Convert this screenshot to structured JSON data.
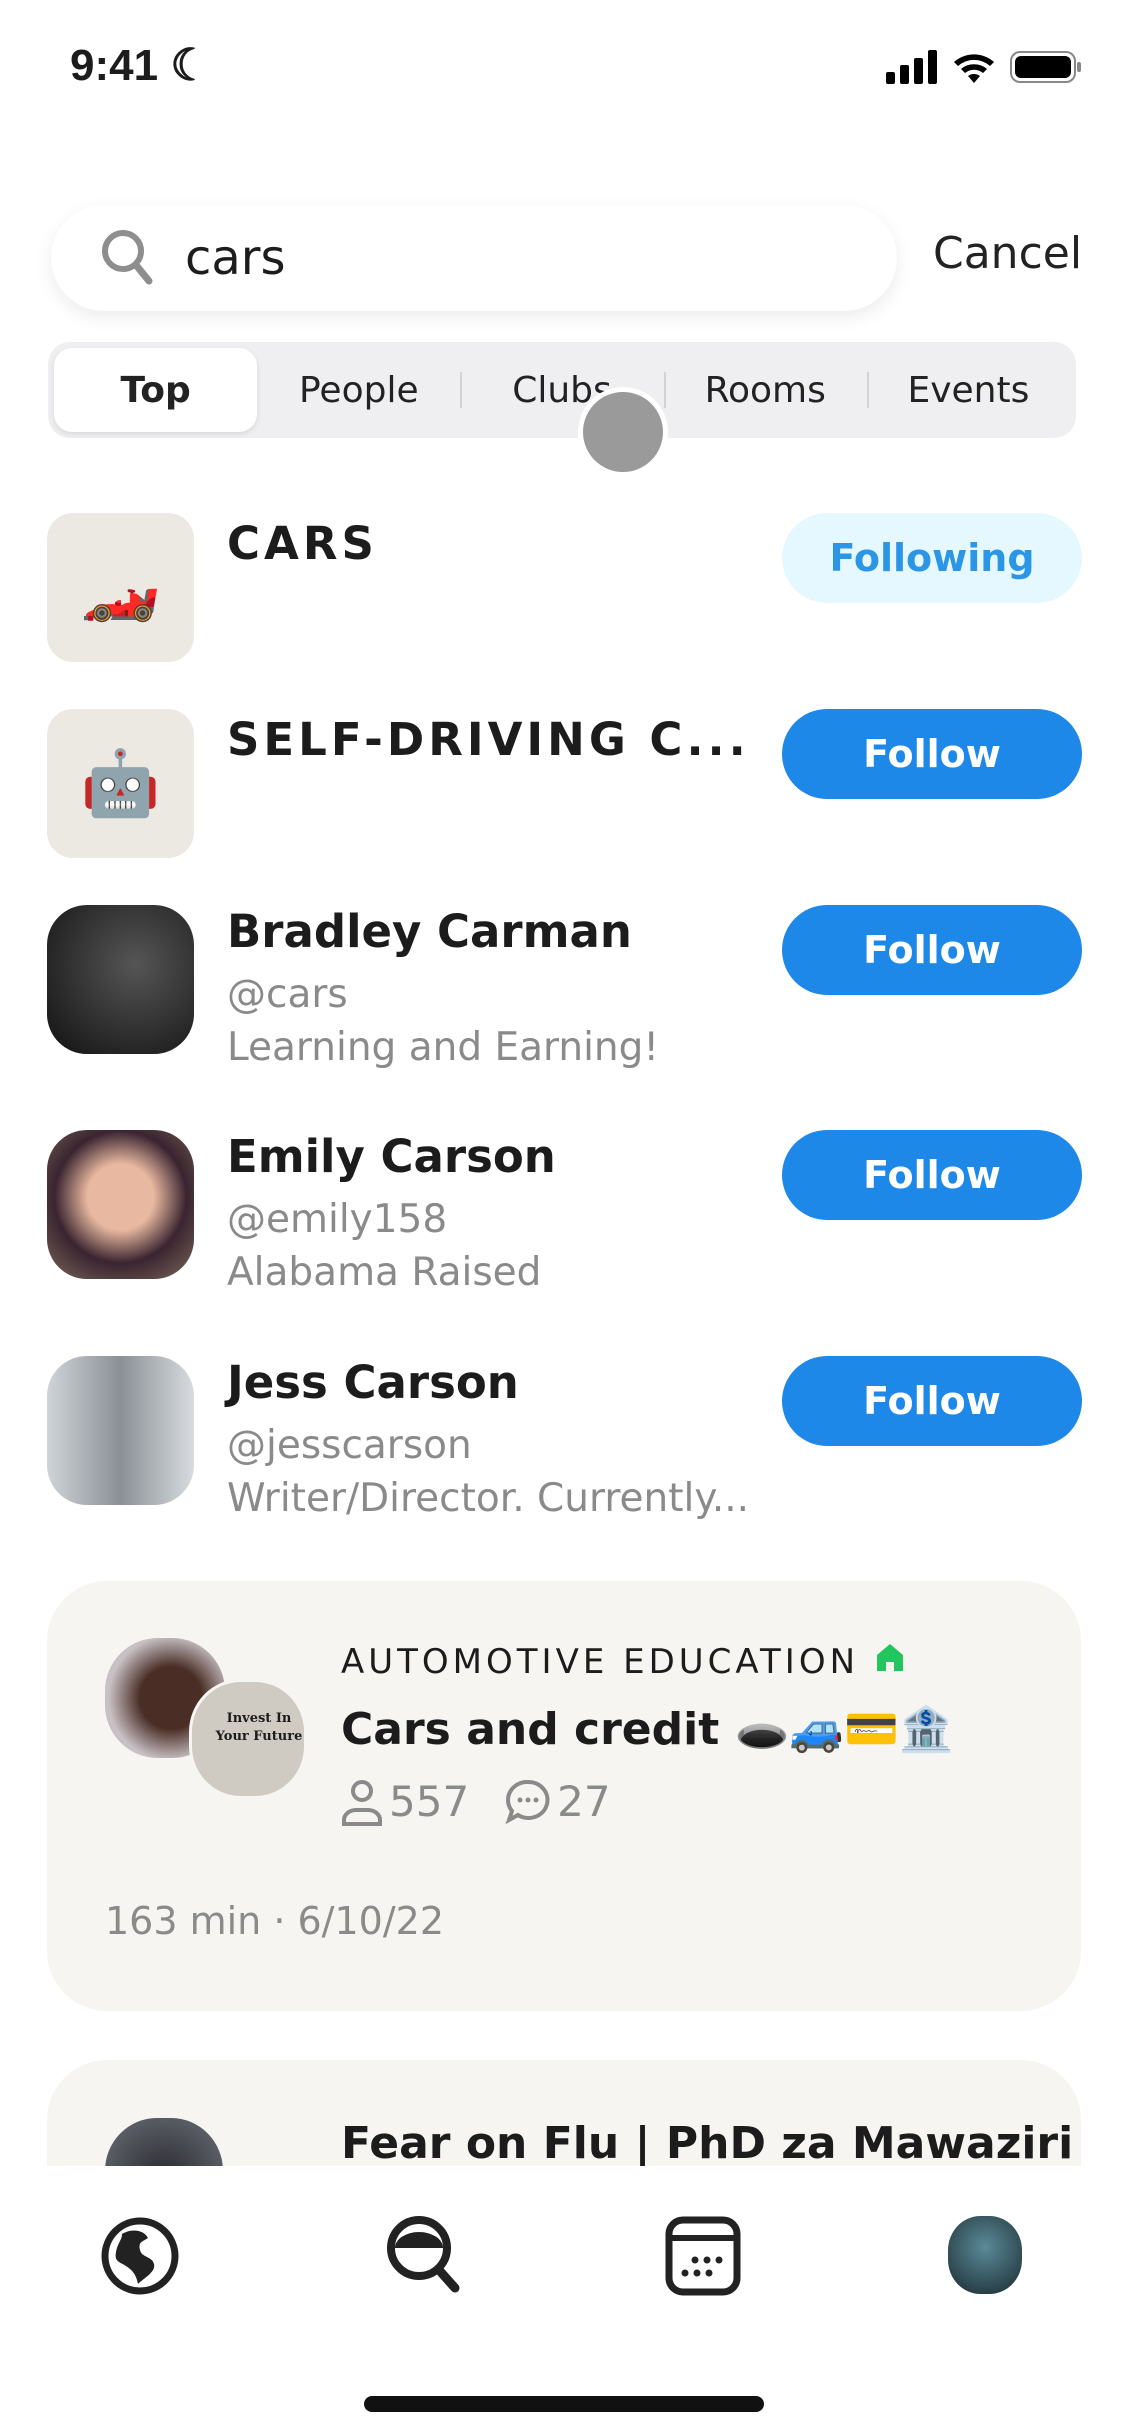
{
  "status": {
    "time": "9:41"
  },
  "search": {
    "value": "cars",
    "cancel": "Cancel"
  },
  "tabs": [
    {
      "label": "Top",
      "active": true
    },
    {
      "label": "People"
    },
    {
      "label": "Clubs"
    },
    {
      "label": "Rooms"
    },
    {
      "label": "Events"
    }
  ],
  "results": [
    {
      "type": "club",
      "name": "CARS",
      "emoji": "🏎️",
      "button": "Following"
    },
    {
      "type": "club",
      "name": "SELF-DRIVING C...",
      "emoji": "🤖",
      "button": "Follow"
    },
    {
      "type": "person",
      "name": "Bradley Carman",
      "handle": "@cars",
      "bio": "Learning and Earning!",
      "button": "Follow"
    },
    {
      "type": "person",
      "name": "Emily Carson",
      "handle": "@emily158",
      "bio": "Alabama Raised",
      "button": "Follow"
    },
    {
      "type": "person",
      "name": "Jess Carson",
      "handle": "@jesscarson",
      "bio": "Writer/Director. Currently...",
      "button": "Follow"
    }
  ],
  "rooms": [
    {
      "club": "AUTOMOTIVE EDUCATION",
      "title": "Cars and credit 🕳️🚙💳🏦",
      "listeners": "557",
      "comments": "27",
      "footer": "163 min · 6/10/22",
      "avatar_text": "Invest In Your Future"
    },
    {
      "title": "Fear on Flu | PhD za Mawaziri"
    }
  ],
  "colors": {
    "accent": "#1e88e9",
    "following_bg": "#e6f8ff",
    "card_bg": "#f6f5f1",
    "club_house": "#22c55e"
  },
  "nav": [
    "globe-icon",
    "search-icon",
    "calendar-icon",
    "profile-avatar"
  ]
}
